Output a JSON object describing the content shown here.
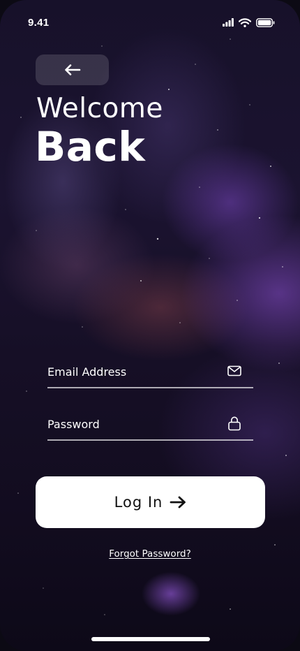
{
  "status_bar": {
    "time": "9.41",
    "icons": [
      "cellular-signal-icon",
      "wifi-icon",
      "battery-icon"
    ]
  },
  "back_button": {
    "icon": "arrow-left-icon"
  },
  "header": {
    "title_line1": "Welcome",
    "title_line2": "Back"
  },
  "form": {
    "email": {
      "placeholder": "Email Address",
      "value": "",
      "icon": "mail-icon"
    },
    "password": {
      "placeholder": "Password",
      "value": "",
      "icon": "lock-icon"
    },
    "login_button": {
      "label": "Log In",
      "icon": "arrow-right-icon"
    },
    "forgot_password": "Forgot Password?"
  },
  "colors": {
    "background_dark": "#150f24",
    "nebula_purple": "#8c50d2",
    "button_bg": "#ffffff",
    "button_text": "#111111",
    "text": "#ffffff"
  }
}
